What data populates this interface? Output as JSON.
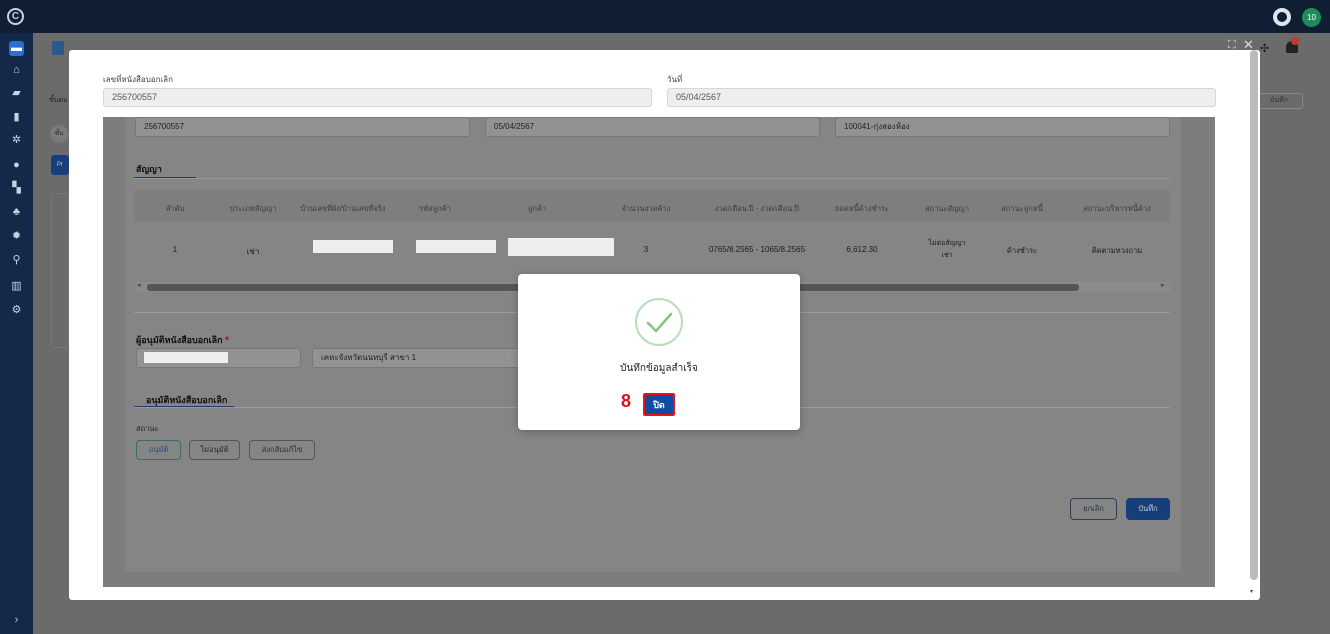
{
  "topbar": {
    "notification_count": "10"
  },
  "form": {
    "doc_no_label": "เลขที่หนังสือบอกเลิก",
    "doc_no_value": "256700557",
    "date_label": "วันที่",
    "date_value": "05/04/2567"
  },
  "inner": {
    "row_values": [
      "256700557",
      "05/04/2567",
      "100041-กุ่งสองห้อง"
    ],
    "contract_tab": "สัญญา",
    "table_headers": [
      "ลำดับ",
      "ประเภทสัญญา",
      "บ้านเลขที่ผัง/บ้านเลขที่จริง",
      "รหัสลูกค้า",
      "ลูกค้า",
      "จำนวนงวดค้าง",
      "งวด/เดือน.ปี - งวด/เดือน.ปี",
      "ยอดหนี้ค้างชำระ",
      "สถานะสัญญา",
      "สถานะลูกหนี้",
      "สถานะบริหารหนี้ค้าง"
    ],
    "table_row": {
      "index": "1",
      "type": "เช่า",
      "overdue": "3",
      "period": "0765/8.2565 - 1065/8.2565",
      "amount": "6,612.30",
      "contract_status_1": "ไม่ต่อสัญญา",
      "contract_status_2": "เช่า",
      "debtor_status": "ค้างชำระ",
      "management_status": "ติดตามทวงถาม"
    },
    "approver_label": "ผู้อนุมัติหนังสือบอกเลิก",
    "approver_branch": "เคหะจังหวัดนนทบุรี สาขา 1",
    "approve_tab": "อนุมัติหนังสือบอกเลิก",
    "status_label": "สถานะ",
    "approve_btn": "อนุมัติ",
    "reject_btn": "ไม่อนุมัติ",
    "return_btn": "ส่งกลับแก้ไข",
    "cancel_btn": "ยกเลิก",
    "save_btn": "บันทึก"
  },
  "background": {
    "save_label": "บันทึก",
    "tab_label": "ขั้นตอ",
    "chip_label": "ขั้น",
    "pr_label": "Pr"
  },
  "dialog": {
    "message": "บันทึกข้อมูลสำเร็จ",
    "close_label": "ปิด",
    "step_number": "8"
  },
  "colors": {
    "primary": "#0f4aa3",
    "success": "#8cc68c",
    "highlight": "#e11111"
  }
}
